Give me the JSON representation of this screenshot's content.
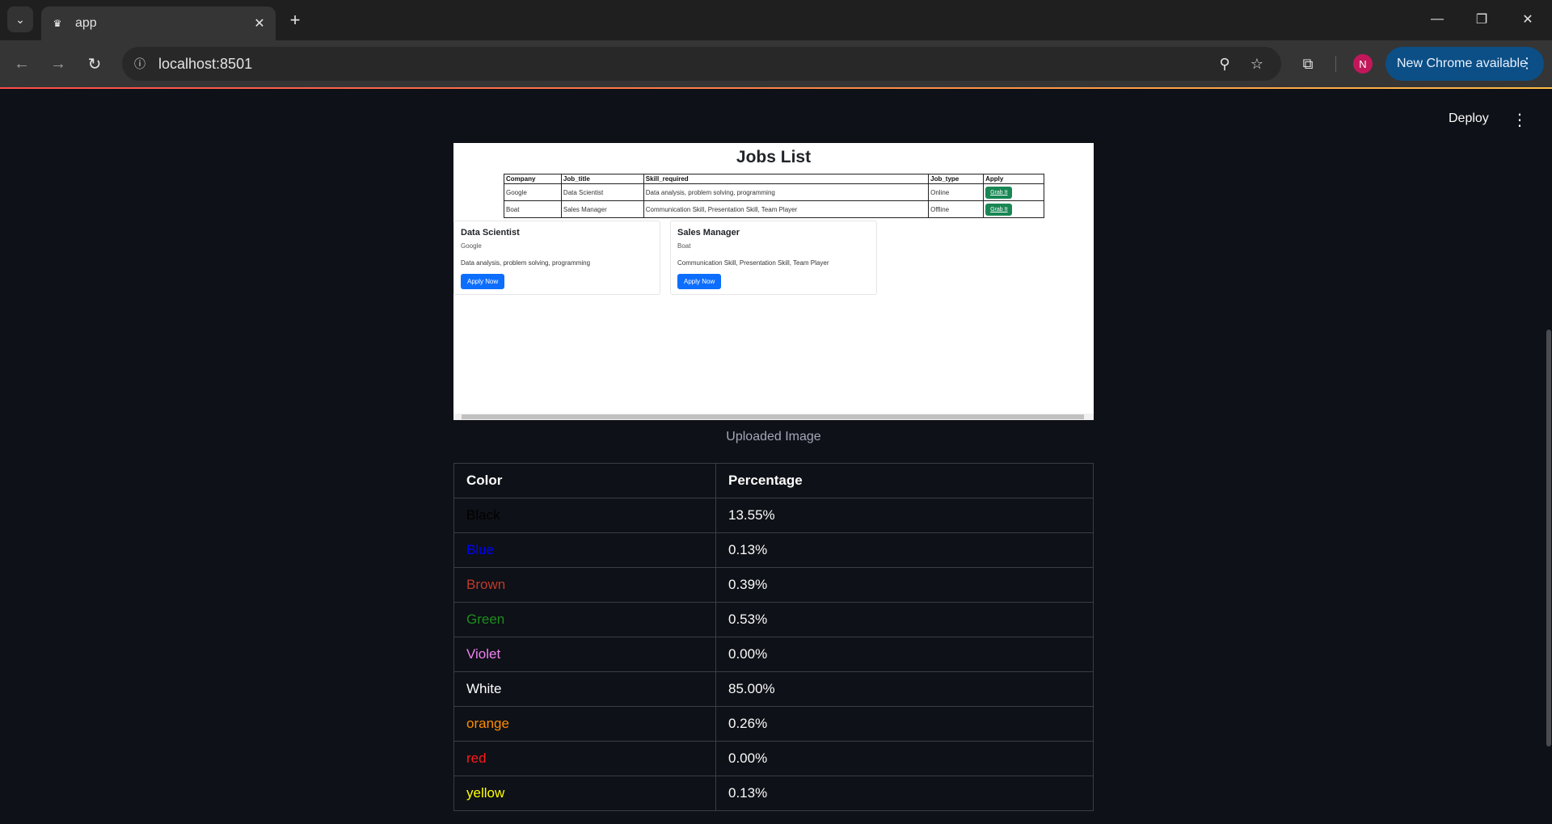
{
  "browser": {
    "tab_title": "app",
    "url": "localhost:8501",
    "profile_initial": "N",
    "update_label": "New Chrome available"
  },
  "app": {
    "deploy_label": "Deploy",
    "caption": "Uploaded Image"
  },
  "uploaded_image": {
    "title": "Jobs List",
    "headers": [
      "Company",
      "Job_title",
      "Skill_required",
      "Job_type",
      "Apply"
    ],
    "rows": [
      {
        "company": "Google",
        "job_title": "Data Scientist",
        "skills": "Data analysis, problem solving, programming",
        "job_type": "Online",
        "apply": "Grab It"
      },
      {
        "company": "Boat",
        "job_title": "Sales Manager",
        "skills": "Communication Skill, Presentation Skill, Team Player",
        "job_type": "Offline",
        "apply": "Grab It"
      }
    ],
    "cards": [
      {
        "title": "Data Scientist",
        "company": "Google",
        "skills": "Data analysis, problem solving, programming",
        "button": "Apply Now"
      },
      {
        "title": "Sales Manager",
        "company": "Boat",
        "skills": "Communication Skill, Presentation Skill, Team Player",
        "button": "Apply Now"
      }
    ]
  },
  "color_table": {
    "headers": [
      "Color",
      "Percentage"
    ],
    "rows": [
      {
        "color": "Black",
        "percentage": "13.55%",
        "hex": "#000000"
      },
      {
        "color": "Blue",
        "percentage": "0.13%",
        "hex": "#0000ff"
      },
      {
        "color": "Brown",
        "percentage": "0.39%",
        "hex": "#c0392b"
      },
      {
        "color": "Green",
        "percentage": "0.53%",
        "hex": "#1e8c1e"
      },
      {
        "color": "Violet",
        "percentage": "0.00%",
        "hex": "#ee82ee"
      },
      {
        "color": "White",
        "percentage": "85.00%",
        "hex": "#ffffff"
      },
      {
        "color": "orange",
        "percentage": "0.26%",
        "hex": "#ff8c00"
      },
      {
        "color": "red",
        "percentage": "0.00%",
        "hex": "#ff1a1a"
      },
      {
        "color": "yellow",
        "percentage": "0.13%",
        "hex": "#ffff00"
      }
    ]
  }
}
